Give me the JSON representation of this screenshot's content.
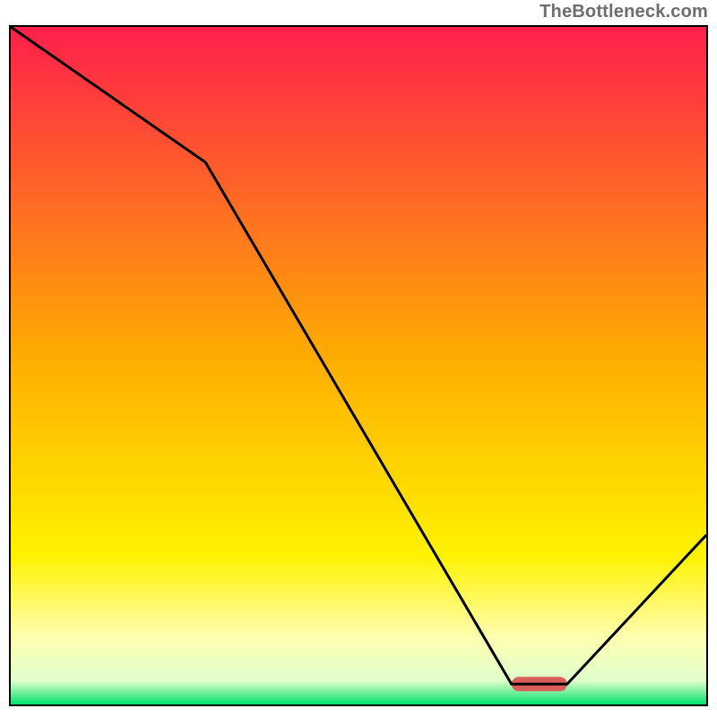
{
  "watermark": "TheBottleneck.com",
  "chart_data": {
    "type": "line",
    "title": "",
    "xlabel": "",
    "ylabel": "",
    "xlim": [
      0,
      100
    ],
    "ylim": [
      0,
      100
    ],
    "grid": false,
    "series": [
      {
        "name": "bottleneck-curve",
        "x": [
          0,
          28,
          72,
          80,
          100
        ],
        "values": [
          100,
          80,
          3,
          3,
          25
        ],
        "stroke": "#000000"
      }
    ],
    "markers": [
      {
        "name": "optimal-marker",
        "x_center": 76,
        "y": 3,
        "width_x_units": 8,
        "color": "#d9605a"
      }
    ],
    "background_gradient": {
      "stops": [
        {
          "offset": 0.0,
          "color": "#ff1f4b"
        },
        {
          "offset": 0.5,
          "color": "#ffb000"
        },
        {
          "offset": 0.78,
          "color": "#fff200"
        },
        {
          "offset": 0.9,
          "color": "#ffffb0"
        },
        {
          "offset": 0.965,
          "color": "#e0ffcc"
        },
        {
          "offset": 1.0,
          "color": "#00e06a"
        }
      ]
    }
  }
}
